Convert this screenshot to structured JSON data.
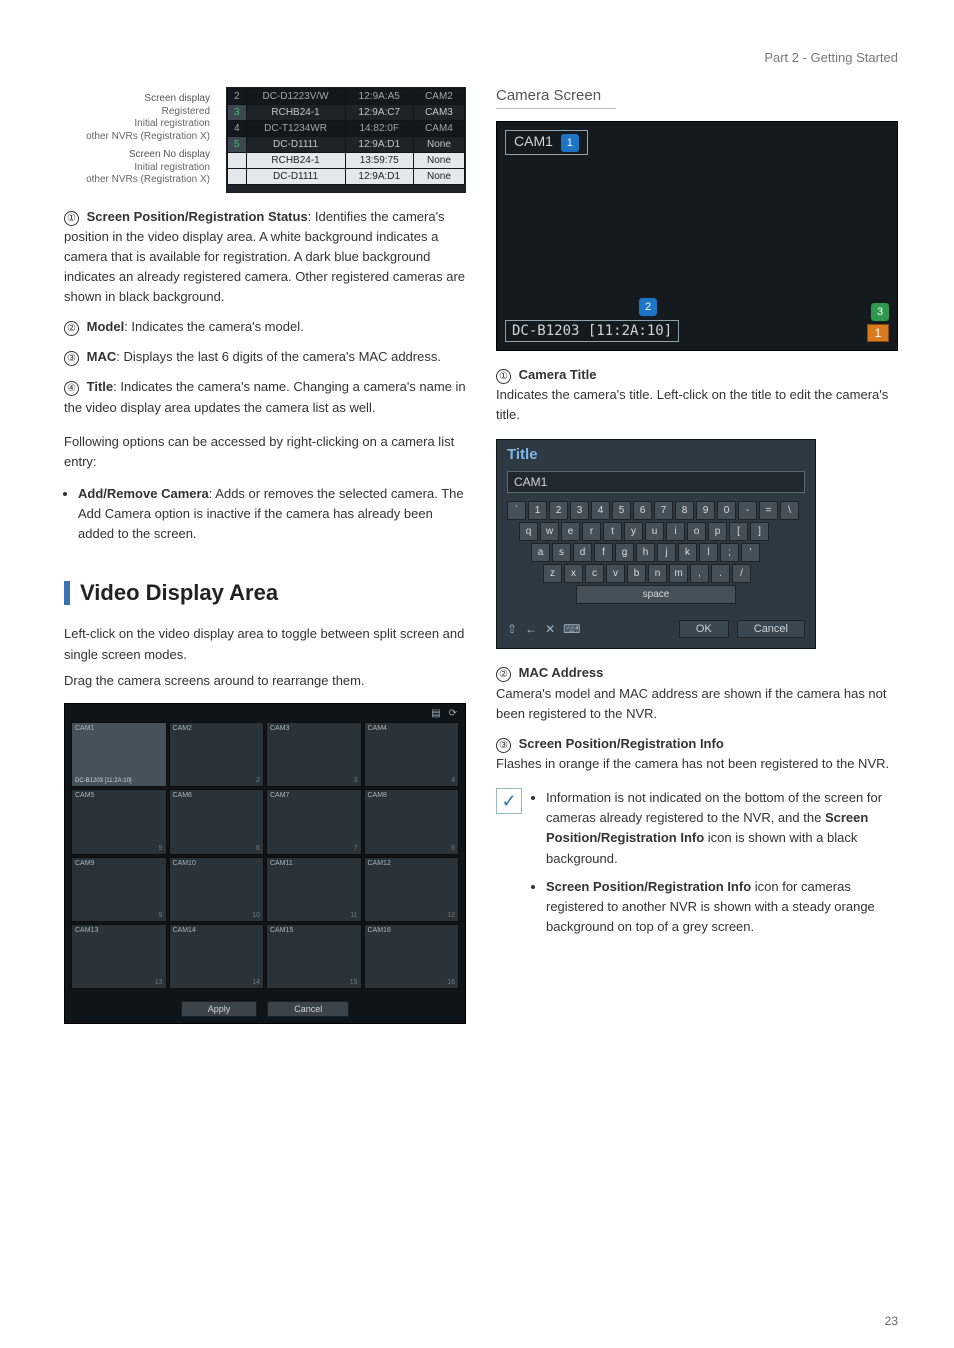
{
  "header": {
    "section": "Part 2 - Getting Started"
  },
  "camlist": {
    "group1_label": "Screen display",
    "group1_items": [
      "Registered",
      "Initial registration",
      "other NVRs (Registration X)"
    ],
    "group2_label": "Screen No display",
    "group2_items": [
      "Initial registration",
      "other NVRs (Registration X)"
    ],
    "rows": [
      {
        "idx": "2",
        "model": "DC-D1223V/W",
        "mac": "12:9A:A5",
        "title": "CAM2",
        "cls": "row-dark"
      },
      {
        "idx": "3",
        "model": "RCHB24-1",
        "mac": "12:9A:C7",
        "title": "CAM3",
        "cls": ""
      },
      {
        "idx": "4",
        "model": "DC-T1234WR",
        "mac": "14:82:0F",
        "title": "CAM4",
        "cls": "row-dark"
      },
      {
        "idx": "5",
        "model": "DC-D1111",
        "mac": "12:9A:D1",
        "title": "None",
        "cls": ""
      },
      {
        "idx": "",
        "model": "RCHB24-1",
        "mac": "13:59:75",
        "title": "None",
        "cls": "row-white"
      },
      {
        "idx": "",
        "model": "DC-D1111",
        "mac": "12:9A:D1",
        "title": "None",
        "cls": "row-white"
      }
    ]
  },
  "defs_left": [
    {
      "n": "①",
      "term": "Screen Position/Registration Status",
      "text": ": Identifies the camera's position in the video display area. A white background indicates a camera that is available for registration. A dark blue background indicates an already registered camera. Other registered cameras are shown in black background."
    },
    {
      "n": "②",
      "term": "Model",
      "text": ": Indicates the camera's model."
    },
    {
      "n": "③",
      "term": "MAC",
      "text": ": Displays the last 6 digits of the camera's MAC address."
    },
    {
      "n": "④",
      "term": "Title",
      "text": ": Indicates the camera's name. Changing a camera's name in the video display area updates the camera list as well."
    }
  ],
  "left_para1": "Following options can be accessed by right-clicking on a camera list entry:",
  "left_bullets": [
    {
      "term": "Add/Remove Camera",
      "text": ": Adds or removes the selected camera. The Add Camera option is inactive if the camera has already been added to the screen."
    }
  ],
  "section2": {
    "title": "Video Display Area"
  },
  "left_para2": "Left-click on the video display area to toggle between split screen and single screen modes.",
  "left_para3": "Drag the camera screens around to rearrange them.",
  "vgrid": {
    "cells": [
      {
        "lbl": "CAM1",
        "bot": "DC-B1203  [11:2A:10]",
        "num": ""
      },
      {
        "lbl": "CAM2",
        "num": "2"
      },
      {
        "lbl": "CAM3",
        "num": "3"
      },
      {
        "lbl": "CAM4",
        "num": "4"
      },
      {
        "lbl": "CAM5",
        "num": "5"
      },
      {
        "lbl": "CAM6",
        "num": "6"
      },
      {
        "lbl": "CAM7",
        "num": "7"
      },
      {
        "lbl": "CAM8",
        "num": "8"
      },
      {
        "lbl": "CAM9",
        "num": "9"
      },
      {
        "lbl": "CAM10",
        "num": "10"
      },
      {
        "lbl": "CAM11",
        "num": "11"
      },
      {
        "lbl": "CAM12",
        "num": "12"
      },
      {
        "lbl": "CAM13",
        "num": "13"
      },
      {
        "lbl": "CAM14",
        "num": "14"
      },
      {
        "lbl": "CAM15",
        "num": "15"
      },
      {
        "lbl": "CAM16",
        "num": "16"
      }
    ],
    "btn_apply": "Apply",
    "btn_cancel": "Cancel"
  },
  "right": {
    "camera_screen_head": "Camera Screen",
    "camshot": {
      "title": "CAM1",
      "tag1": "1",
      "tag2": "2",
      "tag3": "3",
      "bottom": "DC-B1203 [11:2A:10]",
      "rnum": "1"
    },
    "defs": [
      {
        "n": "①",
        "term": "Camera Title",
        "text": "Indicates the camera's title. Left-click on the title to edit the camera's title."
      },
      {
        "n": "②",
        "term": "MAC Address",
        "text": "Camera's model and MAC address are shown if the camera has not been registered to the NVR."
      },
      {
        "n": "③",
        "term": "Screen Position/Registration Info",
        "text": "Flashes in orange if the camera has not been registered to the NVR."
      }
    ],
    "kb": {
      "title": "Title",
      "input": "CAM1",
      "row1": [
        "`",
        "1",
        "2",
        "3",
        "4",
        "5",
        "6",
        "7",
        "8",
        "9",
        "0",
        "-",
        "=",
        "\\"
      ],
      "row2": [
        "q",
        "w",
        "e",
        "r",
        "t",
        "y",
        "u",
        "i",
        "o",
        "p",
        "[",
        "]"
      ],
      "row3": [
        "a",
        "s",
        "d",
        "f",
        "g",
        "h",
        "j",
        "k",
        "l",
        ";",
        "'"
      ],
      "row4": [
        "z",
        "x",
        "c",
        "v",
        "b",
        "n",
        "m",
        ",",
        ".",
        "/"
      ],
      "space": "space",
      "ok": "OK",
      "cancel": "Cancel"
    },
    "note_bullets": [
      "Information is not indicated on the bottom of the screen for cameras already registered to the NVR, and the <b>Screen Position/Registration Info</b> icon is shown with a black background.",
      "<b>Screen Position/Registration Info</b> icon for cameras registered to another NVR is shown with a steady orange background on top of a grey screen."
    ]
  },
  "pagenum": "23"
}
